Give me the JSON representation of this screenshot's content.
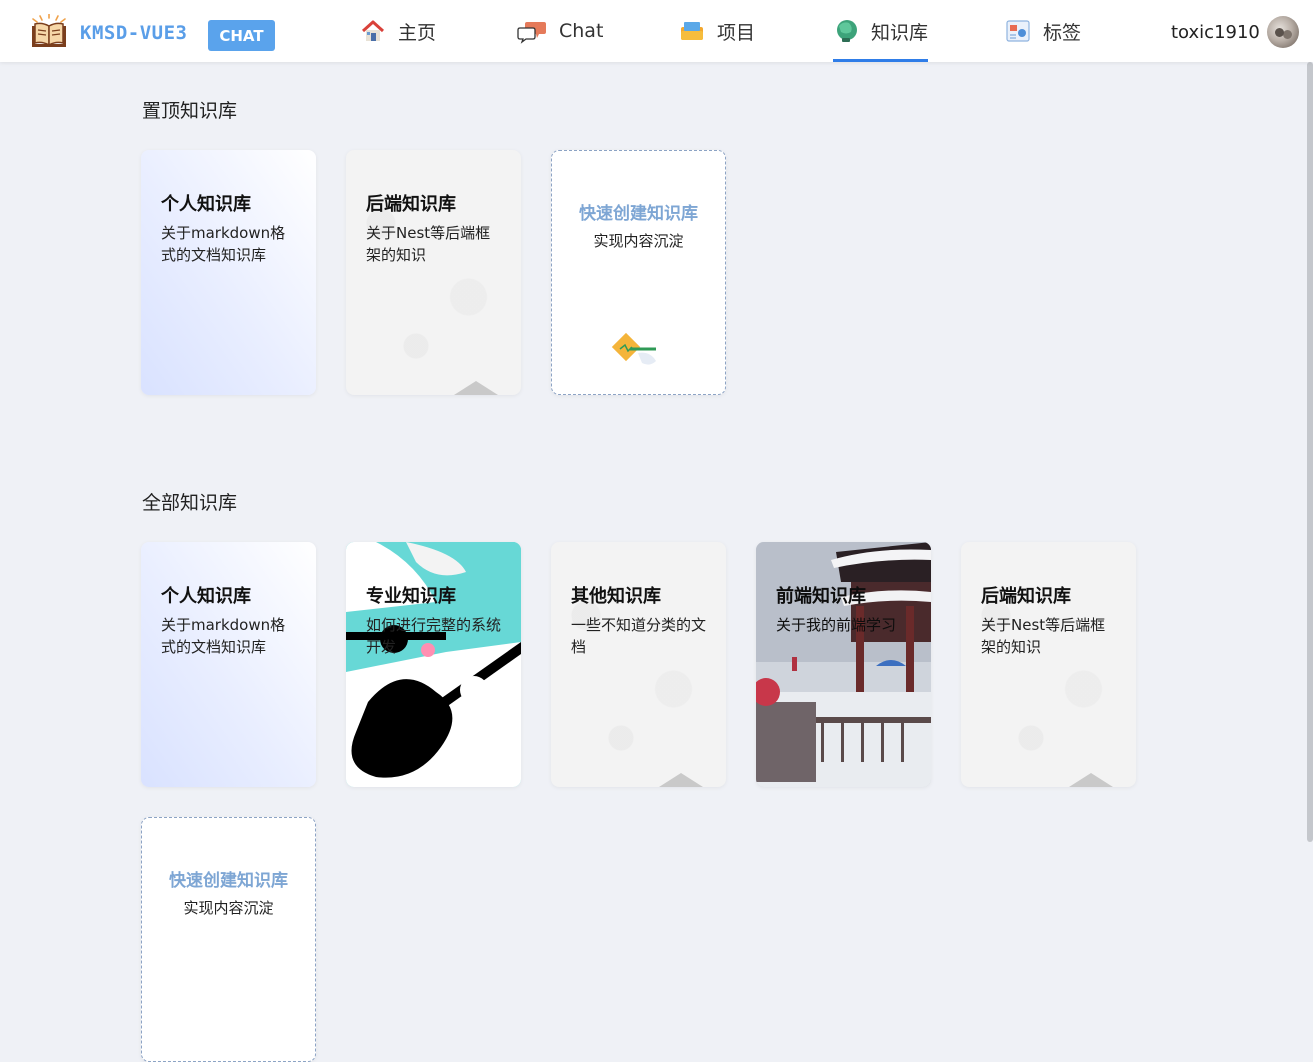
{
  "header": {
    "brand": "KMSD-VUE3",
    "badge": "CHAT",
    "nav": [
      {
        "label": "主页",
        "icon": "home-icon"
      },
      {
        "label": "Chat",
        "icon": "chat-icon"
      },
      {
        "label": "项目",
        "icon": "project-icon"
      },
      {
        "label": "知识库",
        "icon": "knowledge-icon",
        "active": true
      },
      {
        "label": "标签",
        "icon": "tag-icon"
      }
    ],
    "user": "toxic1910"
  },
  "pinned": {
    "title": "置顶知识库",
    "cards": [
      {
        "title": "个人知识库",
        "desc": "关于markdown格式的文档知识库"
      },
      {
        "title": "后端知识库",
        "desc": "关于Nest等后端框架的知识"
      }
    ],
    "create": {
      "title": "快速创建知识库",
      "desc": "实现内容沉淀"
    }
  },
  "all": {
    "title": "全部知识库",
    "cards": [
      {
        "title": "个人知识库",
        "desc": "关于markdown格式的文档知识库"
      },
      {
        "title": "专业知识库",
        "desc": "如何进行完整的系统开发"
      },
      {
        "title": "其他知识库",
        "desc": "一些不知道分类的文档"
      },
      {
        "title": "前端知识库",
        "desc": "关于我的前端学习"
      },
      {
        "title": "后端知识库",
        "desc": "关于Nest等后端框架的知识"
      }
    ],
    "create": {
      "title": "快速创建知识库",
      "desc": "实现内容沉淀"
    }
  },
  "colors": {
    "accent": "#2f7de8",
    "brand": "#5a9ee8",
    "create_title": "#7ea6d4",
    "background": "#eff1f6"
  }
}
